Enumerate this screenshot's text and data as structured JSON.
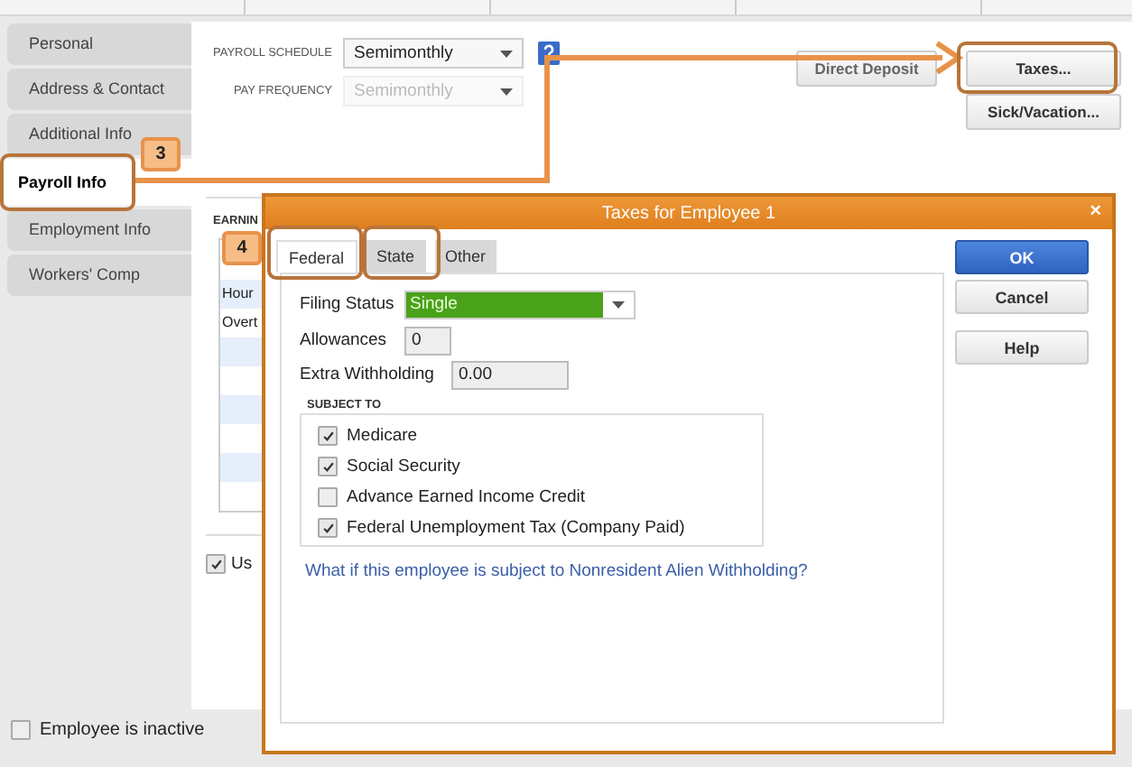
{
  "sidebar": {
    "items": [
      {
        "label": "Personal",
        "selected": false
      },
      {
        "label": "Address & Contact",
        "selected": false
      },
      {
        "label": "Additional Info",
        "selected": false
      },
      {
        "label": "Payroll Info",
        "selected": true
      },
      {
        "label": "Employment Info",
        "selected": false
      },
      {
        "label": "Workers' Comp",
        "selected": false
      }
    ]
  },
  "payroll": {
    "fields": [
      {
        "label": "PAYROLL SCHEDULE",
        "value": "Semimonthly",
        "disabled": false
      },
      {
        "label": "PAY FREQUENCY",
        "value": "Semimonthly",
        "disabled": true
      }
    ],
    "buttons": [
      "Direct Deposit",
      "Taxes...",
      "Sick/Vacation..."
    ]
  },
  "earnings": {
    "title": "EARNIN",
    "rows": [
      "Hour",
      "Overt"
    ],
    "option": {
      "label": "Us",
      "checked": true
    }
  },
  "inactive": {
    "label": "Employee is inactive",
    "checked": false
  },
  "dialog": {
    "title": "Taxes for Employee 1",
    "close": "×",
    "tabs": [
      {
        "label": "Federal",
        "selected": true
      },
      {
        "label": "State",
        "selected": false
      },
      {
        "label": "Other",
        "selected": false
      }
    ],
    "filing_status": {
      "label": "Filing Status",
      "value": "Single"
    },
    "allowances": {
      "label": "Allowances",
      "value": "0"
    },
    "extra_withholding": {
      "label": "Extra Withholding",
      "value": "0.00"
    },
    "subject_to": {
      "title": "SUBJECT TO",
      "items": [
        {
          "label": "Medicare",
          "checked": true
        },
        {
          "label": "Social Security",
          "checked": true
        },
        {
          "label": "Advance Earned Income Credit",
          "checked": false
        },
        {
          "label": "Federal Unemployment Tax (Company Paid)",
          "checked": true
        }
      ]
    },
    "link": "What if this employee is subject to Nonresident Alien Withholding?",
    "buttons": [
      "OK",
      "Cancel",
      "Help"
    ]
  },
  "callouts": [
    {
      "label": "3"
    },
    {
      "label": "4"
    }
  ]
}
